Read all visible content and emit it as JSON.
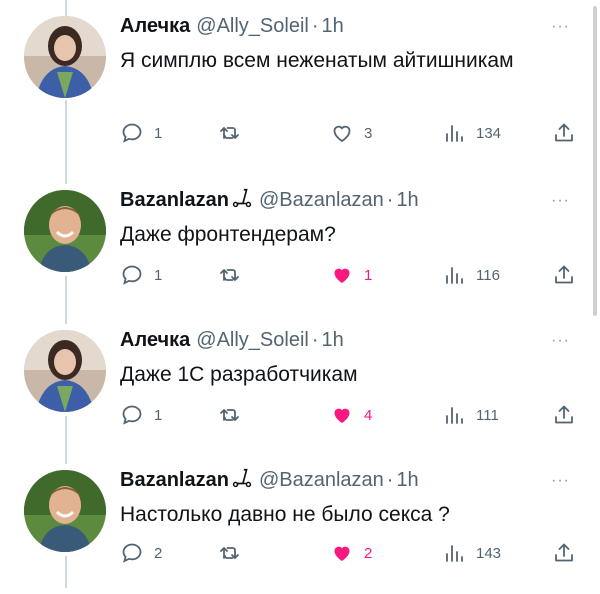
{
  "colors": {
    "text": "#0f1419",
    "secondary": "#536471",
    "like_active": "#f91880",
    "thread_line": "#cfd9de"
  },
  "tweets": [
    {
      "name": "Алечка",
      "handle": "@Ally_Soleil",
      "separator": "·",
      "time": "1h",
      "text": "Я симплю всем неженатым айтишникам",
      "avatar": "avatar-woman",
      "more_icon": "more-dots-icon",
      "replies": "1",
      "retweets": "",
      "likes": "3",
      "liked": false,
      "views": "134"
    },
    {
      "name": "Bazanlazan",
      "name_icon": "scooter-icon",
      "handle": "@Bazanlazan",
      "separator": "·",
      "time": "1h",
      "text": "Даже фронтендерам?",
      "avatar": "avatar-man",
      "more_icon": "more-dots-icon",
      "replies": "1",
      "retweets": "",
      "likes": "1",
      "liked": true,
      "views": "116"
    },
    {
      "name": "Алечка",
      "handle": "@Ally_Soleil",
      "separator": "·",
      "time": "1h",
      "text": "Даже 1С разработчикам",
      "avatar": "avatar-woman",
      "more_icon": "more-dots-icon",
      "replies": "1",
      "retweets": "",
      "likes": "4",
      "liked": true,
      "views": "111"
    },
    {
      "name": "Bazanlazan",
      "name_icon": "scooter-icon",
      "handle": "@Bazanlazan",
      "separator": "·",
      "time": "1h",
      "text": "Настолько давно не было секса ?",
      "avatar": "avatar-man",
      "more_icon": "more-dots-icon",
      "replies": "2",
      "retweets": "",
      "likes": "2",
      "liked": true,
      "views": "143"
    }
  ],
  "more_glyph": "···"
}
